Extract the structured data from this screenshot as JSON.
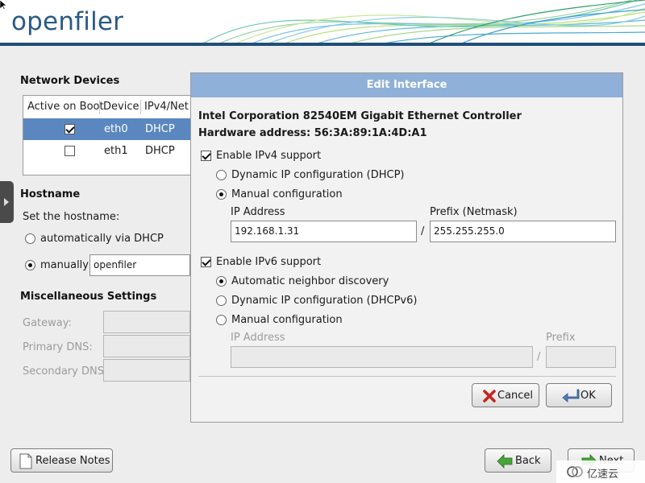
{
  "header": {
    "logo_text": "openfiler"
  },
  "network_devices": {
    "title": "Network Devices",
    "columns": [
      "Active on Boot",
      "Device",
      "IPv4/Net"
    ],
    "rows": [
      {
        "active": true,
        "device": "eth0",
        "ipv4": "DHCP",
        "selected": true
      },
      {
        "active": false,
        "device": "eth1",
        "ipv4": "DHCP",
        "selected": false
      }
    ]
  },
  "hostname": {
    "title": "Hostname",
    "prompt": "Set the hostname:",
    "auto_label": "automatically via DHCP",
    "manual_label": "manually",
    "value": "openfiler",
    "mode": "manual"
  },
  "misc": {
    "title": "Miscellaneous Settings",
    "gateway_label": "Gateway:",
    "primary_dns_label": "Primary DNS:",
    "secondary_dns_label": "Secondary DNS:"
  },
  "dialog": {
    "title": "Edit Interface",
    "controller": "Intel Corporation 82540EM Gigabit Ethernet Controller",
    "hardware_address": "Hardware address: 56:3A:89:1A:4D:A1",
    "ipv4": {
      "enable_label": "Enable IPv4 support",
      "enabled": true,
      "dhcp_label": "Dynamic IP configuration (DHCP)",
      "manual_label": "Manual configuration",
      "mode": "manual",
      "ip_label": "IP Address",
      "ip_value": "192.168.1.31",
      "separator": "/",
      "prefix_label": "Prefix (Netmask)",
      "prefix_value": "255.255.255.0"
    },
    "ipv6": {
      "enable_label": "Enable IPv6 support",
      "enabled": true,
      "auto_label": "Automatic neighbor discovery",
      "dhcp_label": "Dynamic IP configuration (DHCPv6)",
      "manual_label": "Manual configuration",
      "mode": "auto",
      "ip_label": "IP Address",
      "separator": "/",
      "prefix_label": "Prefix"
    },
    "cancel_label": "Cancel",
    "ok_label": "OK"
  },
  "footer": {
    "release_notes_label": "Release Notes",
    "back_label": "Back",
    "next_label": "Next",
    "watermark": "亿速云"
  },
  "colors": {
    "selection": "#5b87c0",
    "dialog_title_bg": "#8fb0d8",
    "logo": "#2a5a86",
    "header_line": "#1f4e79"
  }
}
